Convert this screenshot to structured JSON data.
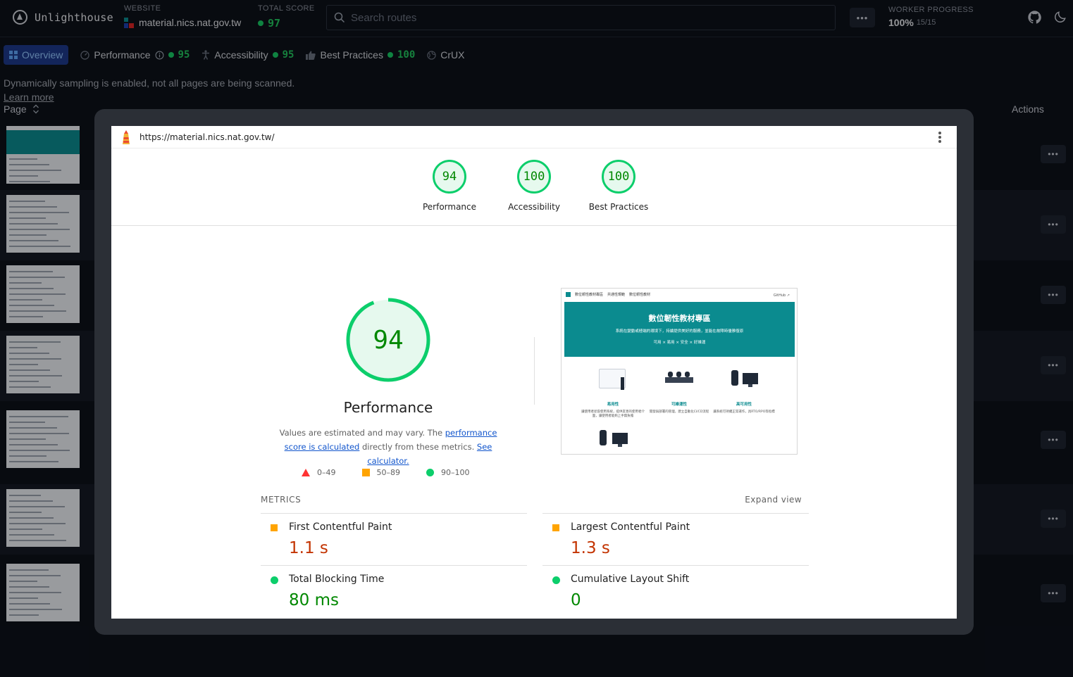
{
  "header": {
    "app_name": "Unlighthouse",
    "website_label": "WEBSITE",
    "website": "material.nics.nat.gov.tw",
    "total_score_label": "TOTAL SCORE",
    "total_score": "97",
    "search_placeholder": "Search routes",
    "more_label": "•••",
    "worker_progress_label": "WORKER PROGRESS",
    "worker_progress_pct": "100%",
    "worker_progress_count": "15/15"
  },
  "tabs": [
    {
      "label": "Overview",
      "score": ""
    },
    {
      "label": "Performance",
      "score": "95"
    },
    {
      "label": "Accessibility",
      "score": "95"
    },
    {
      "label": "Best Practices",
      "score": "100"
    },
    {
      "label": "CrUX",
      "score": ""
    }
  ],
  "notice": {
    "text": "Dynamically sampling is enabled, not all pages are being scanned.",
    "link": "Learn more"
  },
  "columns": {
    "page": "Page",
    "actions": "Actions"
  },
  "row_action_label": "•••",
  "report": {
    "url": "https://material.nics.nat.gov.tw/",
    "gauges": [
      {
        "label": "Performance",
        "score": "94"
      },
      {
        "label": "Accessibility",
        "score": "100"
      },
      {
        "label": "Best Practices",
        "score": "100"
      }
    ],
    "main_score": "94",
    "main_score_fraction": 0.94,
    "main_title": "Performance",
    "explain_prefix": "Values are estimated and may vary. The ",
    "explain_link1": "performance score is calculated",
    "explain_middle": " directly from these metrics. ",
    "explain_link2": "See calculator.",
    "legend": [
      {
        "range": "0–49",
        "color": "#ff3333"
      },
      {
        "range": "50–89",
        "color": "#ffa400"
      },
      {
        "range": "90–100",
        "color": "#0cce6b"
      }
    ],
    "screenshot": {
      "nav_brand": "數位韌性教材專區",
      "nav_links": [
        "共通性規範",
        "數位韌性教材"
      ],
      "nav_right": "GitHub ↗",
      "hero_title": "數位韌性教材專區",
      "hero_subtitle": "系統在變動或極端的環境下，持續提供美好的服務，並能在故障時優雅復原",
      "hero_tags": "可用 × 易用 × 安全 × 好維運",
      "features": [
        {
          "title": "易用性",
          "desc": "讓使用者從容使用系統，提供友善的使用者介面，讓使用者能夠上手無負擔"
        },
        {
          "title": "可維運性",
          "desc": "開發與部署的管理，建立自動化CI/CD流程"
        },
        {
          "title": "高可用性",
          "desc": "讓系統可持續正常運作，具RTO/RPO等指標"
        }
      ]
    },
    "metrics_title": "METRICS",
    "expand_view": "Expand view",
    "metrics": [
      {
        "name": "First Contentful Paint",
        "value": "1.1 s",
        "status": "average"
      },
      {
        "name": "Largest Contentful Paint",
        "value": "1.3 s",
        "status": "average"
      },
      {
        "name": "Total Blocking Time",
        "value": "80 ms",
        "status": "pass"
      },
      {
        "name": "Cumulative Layout Shift",
        "value": "0",
        "status": "pass"
      }
    ]
  },
  "colors": {
    "pass": "#0cce6b",
    "average": "#ffa400",
    "fail": "#ff3333",
    "accent": "#1e3a8a"
  }
}
